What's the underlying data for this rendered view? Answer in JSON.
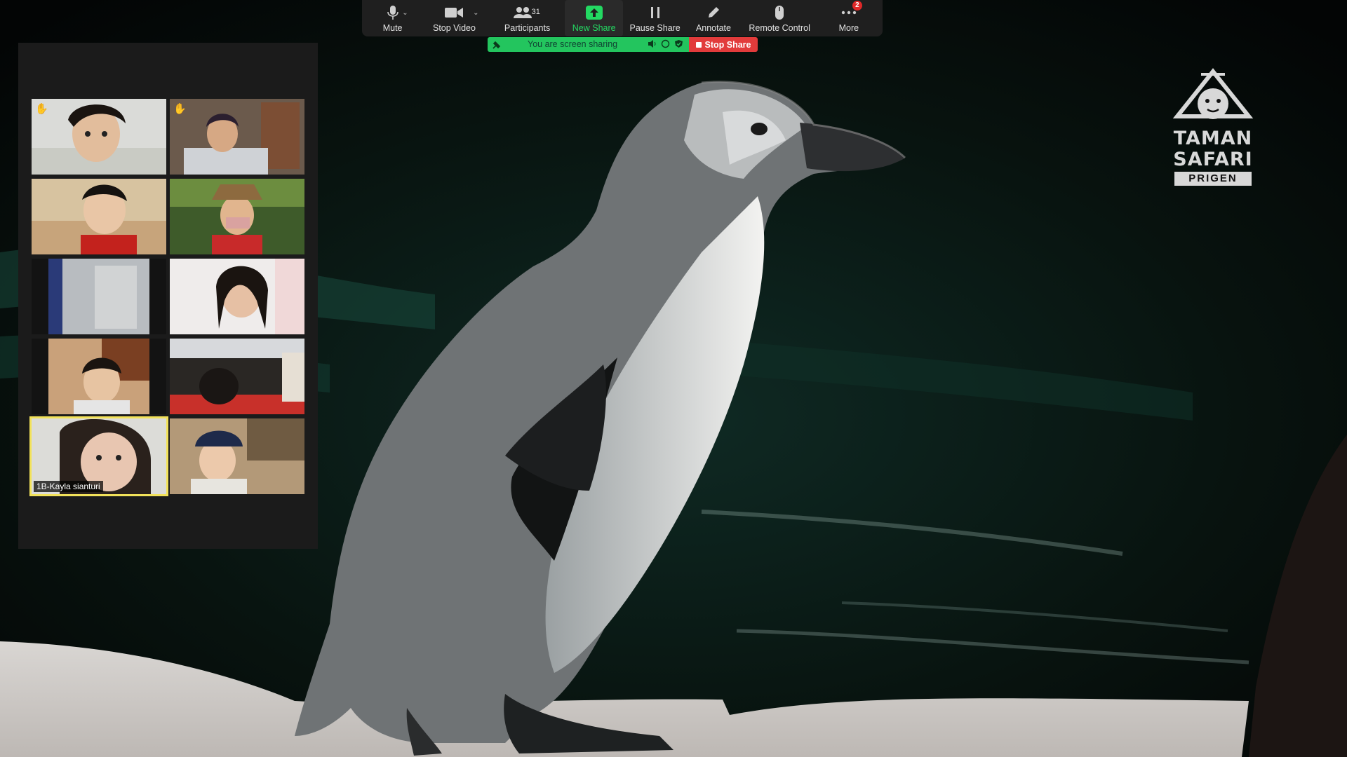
{
  "toolbar": {
    "buttons": [
      {
        "label": "Mute",
        "icon": "microphone-icon"
      },
      {
        "label": "Stop Video",
        "icon": "video-camera-icon"
      },
      {
        "label": "Participants",
        "icon": "participants-icon",
        "count": "31"
      },
      {
        "label": "New Share",
        "icon": "share-up-arrow-icon"
      },
      {
        "label": "Pause Share",
        "icon": "pause-icon"
      },
      {
        "label": "Annotate",
        "icon": "pencil-icon"
      },
      {
        "label": "Remote Control",
        "icon": "mouse-icon"
      },
      {
        "label": "More",
        "icon": "more-dots-icon",
        "badge": "2"
      }
    ]
  },
  "sharing": {
    "status_text": "You are screen sharing",
    "stop_label": "Stop Share"
  },
  "gallery": {
    "tiles": [
      {
        "raised_hand": true
      },
      {
        "raised_hand": true
      },
      {},
      {},
      {},
      {},
      {},
      {},
      {
        "name": "1B-Kayla  sianturi",
        "active_speaker": true
      },
      {}
    ]
  },
  "logo": {
    "line1": "TAMAN",
    "line2": "SAFARI",
    "line3": "PRIGEN"
  },
  "colors": {
    "toolbar_bg": "#1f1f1f",
    "share_green": "#23c55e",
    "stop_red": "#e23b3b",
    "new_share_green": "#23d962",
    "active_speaker_border": "#f2e25a"
  }
}
